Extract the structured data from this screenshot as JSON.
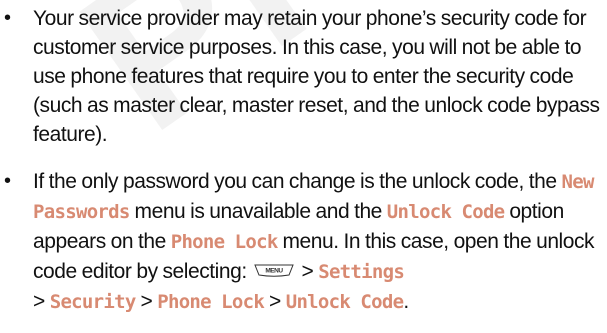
{
  "watermark": {
    "text": "PREVIEW"
  },
  "bullets": {
    "first": {
      "text": "Your service provider may retain your phone’s security code for customer service purposes. In this case, you will not be able to use phone features that require you to enter the security code (such as master clear, master reset, and the unlock code bypass feature)."
    },
    "second": {
      "part1": "If the only password you can change is the unlock code, the ",
      "cmd_new_passwords": "New Passwords",
      "part2": " menu is unavailable and the ",
      "cmd_unlock_code": "Unlock Code",
      "part3": " option appears on the ",
      "cmd_phone_lock": "Phone Lock",
      "part4": " menu. In this case, open the unlock code editor by selecting: ",
      "menu_key_label": "MENU",
      "sep1": " > ",
      "path_settings": "Settings",
      "sep2": " > ",
      "path_security": "Security",
      "sep3": " > ",
      "path_phone_lock": "Phone Lock",
      "sep4": " > ",
      "path_unlock_code": "Unlock Code",
      "end": "."
    }
  },
  "colors": {
    "command_text": "#d88a72",
    "body_text": "#111111",
    "watermark": "#0000000d"
  }
}
